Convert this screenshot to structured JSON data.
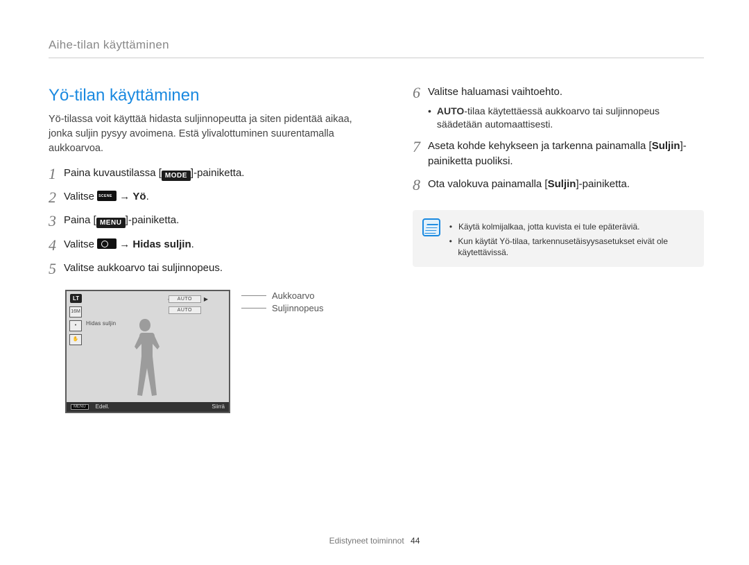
{
  "breadcrumb": "Aihe-tilan käyttäminen",
  "section_title": "Yö-tilan käyttäminen",
  "intro": "Yö-tilassa voit käyttää hidasta suljinnopeutta ja siten pidentää aikaa, jonka suljin pysyy avoimena. Estä ylivalottuminen suurentamalla aukkoarvoa.",
  "icons": {
    "mode": "MODE",
    "menu": "MENU"
  },
  "steps_left": {
    "s1_a": "Paina kuvaustilassa [",
    "s1_b": "]-painiketta.",
    "s2_a": "Valitse ",
    "s2_arrow": " → ",
    "s2_b": "Yö",
    "s2_c": ".",
    "s3_a": "Paina [",
    "s3_b": "]-painiketta.",
    "s4_a": "Valitse ",
    "s4_arrow": " → ",
    "s4_b": "Hidas suljin",
    "s4_c": ".",
    "s5": "Valitse aukkoarvo tai suljinnopeus."
  },
  "lcd": {
    "mode_badge": "LT",
    "auto1": "AUTO",
    "auto2": "AUTO",
    "icons": {
      "size": "16M",
      "dot": "•",
      "hand": "✋"
    },
    "hidas": "Hidas suljin",
    "bottom_menu_icon": "MENU",
    "bottom_left": "Edell.",
    "bottom_right": "Siirrä"
  },
  "legend": {
    "l1": "Aukkoarvo",
    "l2": "Suljinnopeus"
  },
  "steps_right": {
    "s6": "Valitse haluamasi vaihtoehto.",
    "s6_sub_a": "AUTO",
    "s6_sub_b": "-tilaa käytettäessä aukkoarvo tai suljinnopeus säädetään automaattisesti.",
    "s7_a": "Aseta kohde kehykseen ja tarkenna painamalla [",
    "s7_b": "Suljin",
    "s7_c": "]-painiketta puoliksi.",
    "s8_a": "Ota valokuva painamalla [",
    "s8_b": "Suljin",
    "s8_c": "]-painiketta."
  },
  "notes": {
    "n1": "Käytä kolmijalkaa, jotta kuvista ei tule epäteräviä.",
    "n2": "Kun käytät Yö-tilaa, tarkennusetäisyysasetukset eivät ole käytettävissä."
  },
  "footer": {
    "section": "Edistyneet toiminnot",
    "page": "44"
  },
  "nums": {
    "n1": "1",
    "n2": "2",
    "n3": "3",
    "n4": "4",
    "n5": "5",
    "n6": "6",
    "n7": "7",
    "n8": "8"
  }
}
